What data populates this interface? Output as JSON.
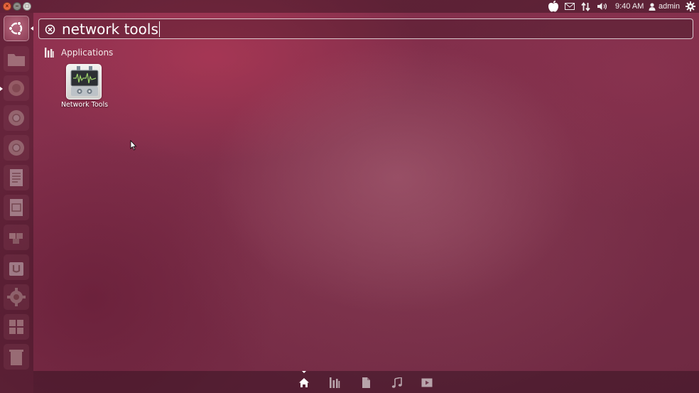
{
  "panel": {
    "clock": "9:40 AM",
    "user": "admin",
    "window_buttons": {
      "close": "×",
      "minimize": "–",
      "maximize": "□"
    }
  },
  "launcher": {
    "items": [
      {
        "name": "dash-home",
        "icon": "ubuntu-logo-icon"
      },
      {
        "name": "files",
        "icon": "folder-icon"
      },
      {
        "name": "firefox",
        "icon": "browser-icon"
      },
      {
        "name": "chromium",
        "icon": "browser-icon"
      },
      {
        "name": "chromium-2",
        "icon": "browser-icon"
      },
      {
        "name": "writer",
        "icon": "document-icon"
      },
      {
        "name": "impress",
        "icon": "presentation-icon"
      },
      {
        "name": "puzzle",
        "icon": "puzzle-icon"
      },
      {
        "name": "software-center",
        "icon": "shopping-bag-icon"
      },
      {
        "name": "settings",
        "icon": "gear-icon"
      },
      {
        "name": "workspaces",
        "icon": "workspace-icon"
      },
      {
        "name": "trash",
        "icon": "trash-icon"
      }
    ]
  },
  "search": {
    "value": "network tools",
    "clear_icon": "clear-icon"
  },
  "results": {
    "category": "Applications",
    "items": [
      {
        "label": "Network Tools",
        "icon": "network-tools-icon"
      }
    ]
  },
  "lenses": [
    {
      "name": "home",
      "icon": "home-icon",
      "active": true
    },
    {
      "name": "applications",
      "icon": "applications-icon",
      "active": false
    },
    {
      "name": "files",
      "icon": "file-icon",
      "active": false
    },
    {
      "name": "music",
      "icon": "music-note-icon",
      "active": false
    },
    {
      "name": "video",
      "icon": "video-icon",
      "active": false
    }
  ],
  "colors": {
    "accent": "#e9663f",
    "background": "#7d2e49"
  }
}
